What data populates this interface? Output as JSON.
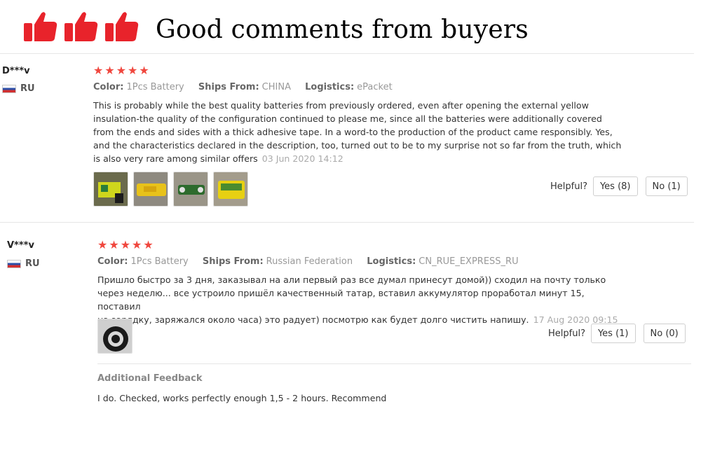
{
  "header": {
    "title": "Good comments from buyers",
    "thumb_icon": "thumbs-up-icon",
    "thumb_color": "#e8232b"
  },
  "reviews": [
    {
      "user": "D***v",
      "country": "RU",
      "rating": 5,
      "color_label": "Color:",
      "color_value": "1Pcs Battery",
      "ships_label": "Ships From:",
      "ships_value": "CHINA",
      "logistics_label": "Logistics:",
      "logistics_value": "ePacket",
      "text_lines": [
        "This is probably while the best quality batteries from previously ordered, even after opening the external yellow",
        "insulation-the quality of the configuration continued to please me, since all the batteries were additionally covered",
        "from the ends and sides with a thick adhesive tape. In a word-to the production of the product came responsibly. Yes,",
        "and the characteristics declared in the description, too, turned out to be to my surprise not so far from the truth, which",
        "is also very rare among similar offers"
      ],
      "date": "03 Jun 2020 14:12",
      "helpful_label": "Helpful?",
      "yes_label": "Yes (8)",
      "no_label": "No (1)"
    },
    {
      "user": "V***v",
      "country": "RU",
      "rating": 5,
      "color_label": "Color:",
      "color_value": "1Pcs Battery",
      "ships_label": "Ships From:",
      "ships_value": "Russian Federation",
      "logistics_label": "Logistics:",
      "logistics_value": "CN_RUE_EXPRESS_RU",
      "text_lines": [
        "Пришло быстро за 3 дня, заказывал на али первый раз все думал принесут домой)) сходил на почту только",
        "через неделю... все устроило пришёл качественный татар, вставил аккумулятор проработал минут 15, поставил",
        "на зарядку, заряжался около часа) это радует) посмотрю как будет долго чистить напишу."
      ],
      "date": "17 Aug 2020 09:15",
      "helpful_label": "Helpful?",
      "yes_label": "Yes (1)",
      "no_label": "No (0)",
      "additional_title": "Additional Feedback",
      "additional_text": "I do. Checked, works perfectly enough 1,5 - 2 hours. Recommend"
    }
  ]
}
